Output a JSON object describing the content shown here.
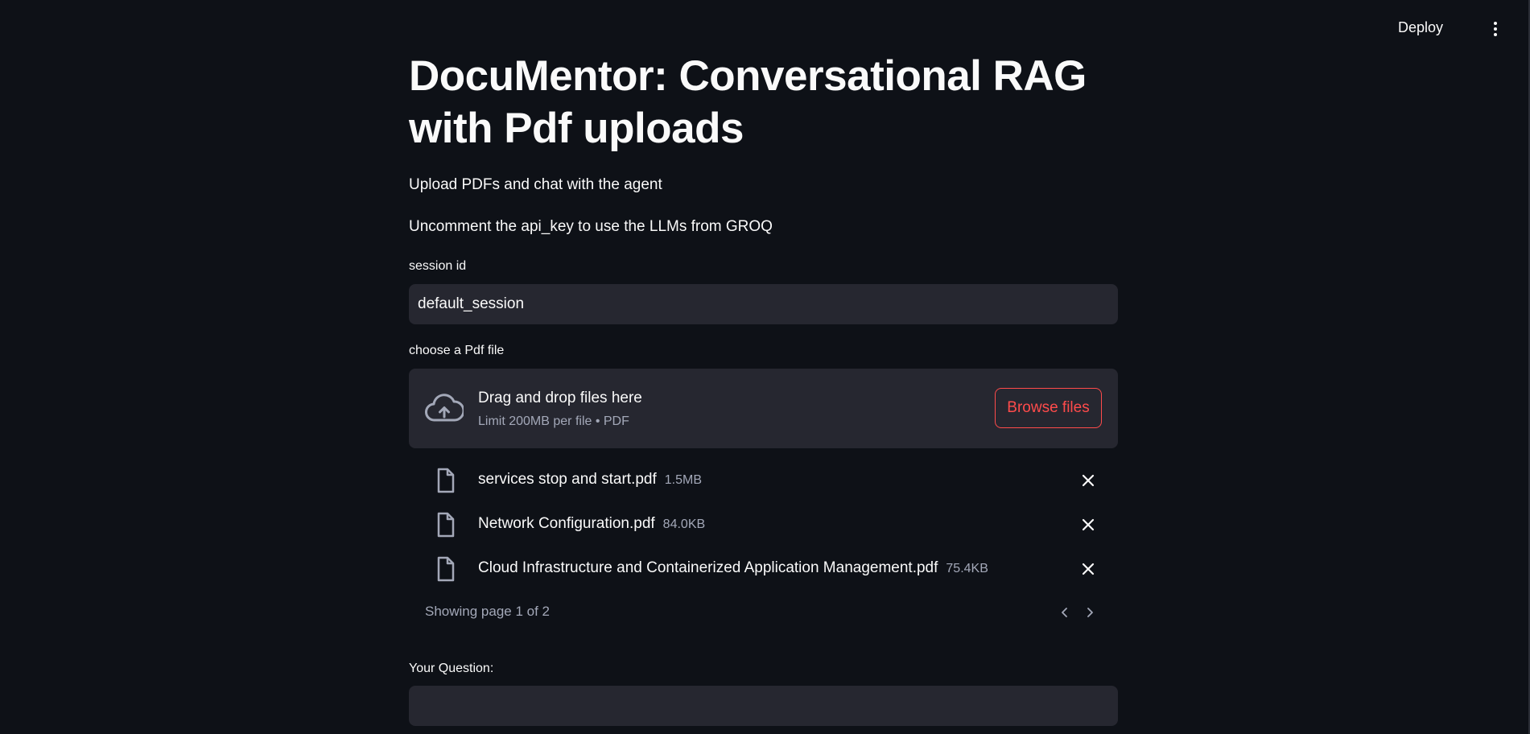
{
  "header": {
    "deploy_label": "Deploy",
    "menu_icon": "more-vertical-icon"
  },
  "main": {
    "title": "DocuMentor: Conversational RAG with Pdf uploads",
    "intro": "Upload PDFs and chat with the agent",
    "note": "Uncomment the api_key to use the LLMs from GROQ"
  },
  "session": {
    "label": "session id",
    "value": "default_session"
  },
  "uploader": {
    "label": "choose a Pdf file",
    "drop_title": "Drag and drop files here",
    "limit_text": "Limit 200MB per file • PDF",
    "browse_label": "Browse files",
    "icon": "cloud-upload-icon",
    "files": [
      {
        "name": "services stop and start.pdf",
        "size": "1.5MB"
      },
      {
        "name": "Network Configuration.pdf",
        "size": "84.0KB"
      },
      {
        "name": "Cloud Infrastructure and Containerized Application Management.pdf",
        "size": "75.4KB"
      }
    ],
    "pager_text": "Showing page 1 of 2"
  },
  "question": {
    "label": "Your Question:",
    "value": ""
  },
  "colors": {
    "background": "#0e1117",
    "input_bg": "#262730",
    "accent": "#ff4b4b",
    "muted_text": "#a3a8b8"
  }
}
